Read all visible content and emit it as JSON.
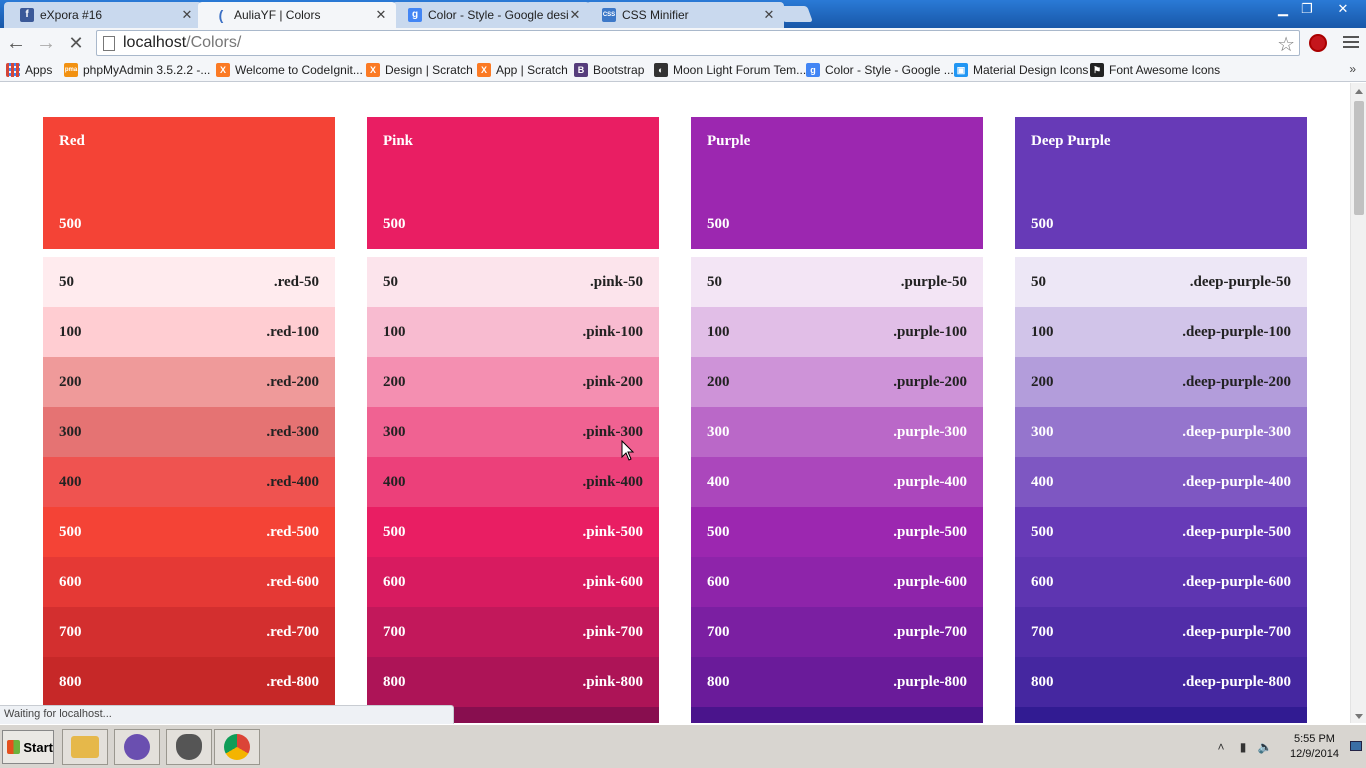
{
  "browser": {
    "tabs": [
      {
        "title": "eXpora #16",
        "icon": "facebook-icon",
        "color": "#3b5998",
        "glyph": "f"
      },
      {
        "title": "AuliaYF | Colors",
        "icon": "loading-spinner-icon",
        "color": "#3a6fc4",
        "glyph": "("
      },
      {
        "title": "Color - Style - Google design",
        "icon": "google-icon",
        "color": "#4285f4",
        "glyph": "g"
      },
      {
        "title": "CSS Minifier",
        "icon": "css-icon",
        "color": "#3c78c8",
        "glyph": "CSS"
      }
    ],
    "url_host": "localhost",
    "url_path": "/Colors/",
    "bookmarks": [
      {
        "label": "Apps",
        "icon": "apps-grid-icon",
        "color": "#d44638",
        "glyph": ""
      },
      {
        "label": "phpMyAdmin 3.5.2.2 -...",
        "icon": "phpmyadmin-icon",
        "color": "#f29111",
        "glyph": "pma"
      },
      {
        "label": "Welcome to CodeIgnit...",
        "icon": "xampp-icon",
        "color": "#fb7a24",
        "glyph": "X"
      },
      {
        "label": "Design | Scratch",
        "icon": "xampp-icon",
        "color": "#fb7a24",
        "glyph": "X"
      },
      {
        "label": "App | Scratch",
        "icon": "xampp-icon",
        "color": "#fb7a24",
        "glyph": "X"
      },
      {
        "label": "Bootstrap",
        "icon": "bootstrap-icon",
        "color": "#563d7c",
        "glyph": "B"
      },
      {
        "label": "Moon Light Forum Tem...",
        "icon": "moon-icon",
        "color": "#333333",
        "glyph": "◐"
      },
      {
        "label": "Color - Style - Google ...",
        "icon": "google-icon",
        "color": "#4285f4",
        "glyph": "g"
      },
      {
        "label": "Material Design Icons",
        "icon": "material-icon",
        "color": "#2196f3",
        "glyph": "▣"
      },
      {
        "label": "Font Awesome Icons",
        "icon": "flag-icon",
        "color": "#222222",
        "glyph": "⚑"
      }
    ],
    "bookmarks_more": "»",
    "status": "Waiting for localhost..."
  },
  "palettes": [
    {
      "name": "Red",
      "primary": "500",
      "primary_color": "#f44336",
      "swatches": [
        {
          "shade": "50",
          "cls": ".red-50",
          "bg": "#ffebee",
          "fg": "#222"
        },
        {
          "shade": "100",
          "cls": ".red-100",
          "bg": "#ffcdd2",
          "fg": "#222"
        },
        {
          "shade": "200",
          "cls": ".red-200",
          "bg": "#ef9a9a",
          "fg": "#222"
        },
        {
          "shade": "300",
          "cls": ".red-300",
          "bg": "#e57373",
          "fg": "#222"
        },
        {
          "shade": "400",
          "cls": ".red-400",
          "bg": "#ef5350",
          "fg": "#222"
        },
        {
          "shade": "500",
          "cls": ".red-500",
          "bg": "#f44336",
          "fg": "#fff"
        },
        {
          "shade": "600",
          "cls": ".red-600",
          "bg": "#e53935",
          "fg": "#fff"
        },
        {
          "shade": "700",
          "cls": ".red-700",
          "bg": "#d32f2f",
          "fg": "#fff"
        },
        {
          "shade": "800",
          "cls": ".red-800",
          "bg": "#c62828",
          "fg": "#fff"
        },
        {
          "shade": "",
          "cls": "",
          "bg": "#b71c1c",
          "fg": "#fff"
        }
      ]
    },
    {
      "name": "Pink",
      "primary": "500",
      "primary_color": "#e91e63",
      "swatches": [
        {
          "shade": "50",
          "cls": ".pink-50",
          "bg": "#fce4ec",
          "fg": "#222"
        },
        {
          "shade": "100",
          "cls": ".pink-100",
          "bg": "#f8bbd0",
          "fg": "#222"
        },
        {
          "shade": "200",
          "cls": ".pink-200",
          "bg": "#f48fb1",
          "fg": "#222"
        },
        {
          "shade": "300",
          "cls": ".pink-300",
          "bg": "#f06292",
          "fg": "#222"
        },
        {
          "shade": "400",
          "cls": ".pink-400",
          "bg": "#ec407a",
          "fg": "#222"
        },
        {
          "shade": "500",
          "cls": ".pink-500",
          "bg": "#e91e63",
          "fg": "#fff"
        },
        {
          "shade": "600",
          "cls": ".pink-600",
          "bg": "#d81b60",
          "fg": "#fff"
        },
        {
          "shade": "700",
          "cls": ".pink-700",
          "bg": "#c2185b",
          "fg": "#fff"
        },
        {
          "shade": "800",
          "cls": ".pink-800",
          "bg": "#ad1457",
          "fg": "#fff"
        },
        {
          "shade": "",
          "cls": "",
          "bg": "#880e4f",
          "fg": "#fff"
        }
      ]
    },
    {
      "name": "Purple",
      "primary": "500",
      "primary_color": "#9c27b0",
      "swatches": [
        {
          "shade": "50",
          "cls": ".purple-50",
          "bg": "#f3e5f5",
          "fg": "#222"
        },
        {
          "shade": "100",
          "cls": ".purple-100",
          "bg": "#e1bee7",
          "fg": "#222"
        },
        {
          "shade": "200",
          "cls": ".purple-200",
          "bg": "#ce93d8",
          "fg": "#222"
        },
        {
          "shade": "300",
          "cls": ".purple-300",
          "bg": "#ba68c8",
          "fg": "#fff"
        },
        {
          "shade": "400",
          "cls": ".purple-400",
          "bg": "#ab47bc",
          "fg": "#fff"
        },
        {
          "shade": "500",
          "cls": ".purple-500",
          "bg": "#9c27b0",
          "fg": "#fff"
        },
        {
          "shade": "600",
          "cls": ".purple-600",
          "bg": "#8e24aa",
          "fg": "#fff"
        },
        {
          "shade": "700",
          "cls": ".purple-700",
          "bg": "#7b1fa2",
          "fg": "#fff"
        },
        {
          "shade": "800",
          "cls": ".purple-800",
          "bg": "#6a1b9a",
          "fg": "#fff"
        },
        {
          "shade": "",
          "cls": "",
          "bg": "#4a148c",
          "fg": "#fff"
        }
      ]
    },
    {
      "name": "Deep Purple",
      "primary": "500",
      "primary_color": "#673ab7",
      "swatches": [
        {
          "shade": "50",
          "cls": ".deep-purple-50",
          "bg": "#ede7f6",
          "fg": "#222"
        },
        {
          "shade": "100",
          "cls": ".deep-purple-100",
          "bg": "#d1c4e9",
          "fg": "#222"
        },
        {
          "shade": "200",
          "cls": ".deep-purple-200",
          "bg": "#b39ddb",
          "fg": "#222"
        },
        {
          "shade": "300",
          "cls": ".deep-purple-300",
          "bg": "#9575cd",
          "fg": "#fff"
        },
        {
          "shade": "400",
          "cls": ".deep-purple-400",
          "bg": "#7e57c2",
          "fg": "#fff"
        },
        {
          "shade": "500",
          "cls": ".deep-purple-500",
          "bg": "#673ab7",
          "fg": "#fff"
        },
        {
          "shade": "600",
          "cls": ".deep-purple-600",
          "bg": "#5e35b1",
          "fg": "#fff"
        },
        {
          "shade": "700",
          "cls": ".deep-purple-700",
          "bg": "#512da8",
          "fg": "#fff"
        },
        {
          "shade": "800",
          "cls": ".deep-purple-800",
          "bg": "#4527a0",
          "fg": "#fff"
        },
        {
          "shade": "",
          "cls": "",
          "bg": "#311b92",
          "fg": "#fff"
        }
      ]
    }
  ],
  "taskbar": {
    "start_label": "Start",
    "apps": [
      {
        "name": "file-explorer-icon",
        "color": "#e6b84a"
      },
      {
        "name": "cat-app-icon",
        "color": "#6a4fb0"
      },
      {
        "name": "alien-app-icon",
        "color": "#555555"
      },
      {
        "name": "chrome-icon",
        "color": "#db4437"
      }
    ],
    "time": "5:55 PM",
    "date": "12/9/2014"
  }
}
